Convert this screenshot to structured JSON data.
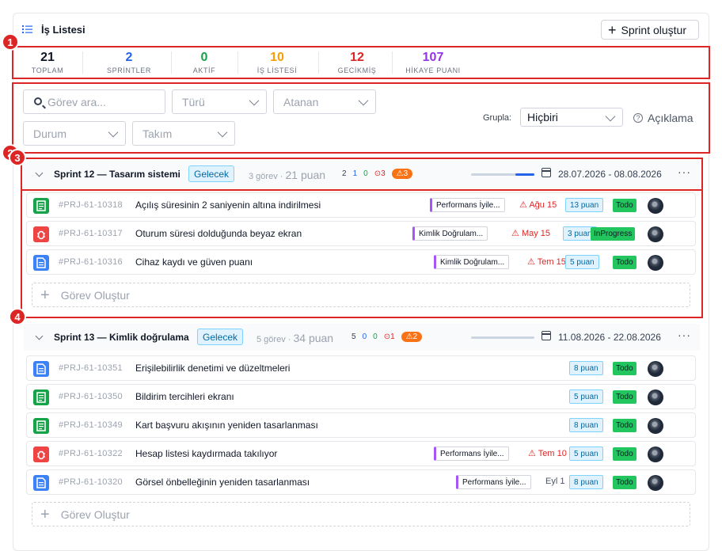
{
  "header": {
    "title": "İş Listesi",
    "create_sprint": "Sprint oluştur"
  },
  "stats": [
    {
      "value": "21",
      "label": "TOPLAM",
      "color": "#111827"
    },
    {
      "value": "2",
      "label": "SPRİNTLER",
      "color": "#2563eb"
    },
    {
      "value": "0",
      "label": "AKTİF",
      "color": "#16a34a"
    },
    {
      "value": "10",
      "label": "İŞ LİSTESİ",
      "color": "#f59e0b"
    },
    {
      "value": "12",
      "label": "GECİKMİŞ",
      "color": "#dc2626"
    },
    {
      "value": "107",
      "label": "HİKAYE PUANI",
      "color": "#9333ea"
    }
  ],
  "filters": {
    "search_placeholder": "Görev ara...",
    "type": "Türü",
    "assignee": "Atanan",
    "status": "Durum",
    "team": "Takım",
    "group_label": "Grupla:",
    "group_value": "Hiçbiri",
    "legend": "Açıklama"
  },
  "annotations": [
    "1",
    "2",
    "3",
    "4"
  ],
  "sprints": [
    {
      "name": "Sprint 12 — Tasarım sistemi",
      "status": "Gelecek",
      "task_count": "3 görev",
      "points": "21 puan",
      "c1": "2",
      "c2": "1",
      "c3": "0",
      "overdue": "3",
      "warn": "3",
      "dates": "28.07.2026 - 08.08.2026",
      "progress": 0.3,
      "tasks": [
        {
          "type": "story",
          "id": "#PRJ-61-10318",
          "title": "Açılış süresinin 2 saniyenin altına indirilmesi",
          "epic": "Performans İyile...",
          "due": "Ağu 15",
          "overdue": true,
          "points": "13 puan",
          "status": "Todo"
        },
        {
          "type": "bug",
          "id": "#PRJ-61-10317",
          "title": "Oturum süresi dolduğunda beyaz ekran",
          "epic": "Kimlik Doğrulam...",
          "due": "May 15",
          "overdue": true,
          "points": "3 puan",
          "status": "InProgress"
        },
        {
          "type": "task",
          "id": "#PRJ-61-10316",
          "title": "Cihaz kaydı ve güven puanı",
          "epic": "Kimlik Doğrulam...",
          "due": "Tem 15",
          "overdue": true,
          "points": "5 puan",
          "status": "Todo"
        }
      ],
      "create_label": "Görev Oluştur"
    },
    {
      "name": "Sprint 13 — Kimlik doğrulama",
      "status": "Gelecek",
      "task_count": "5 görev",
      "points": "34 puan",
      "c1": "5",
      "c2": "0",
      "c3": "0",
      "overdue": "1",
      "warn": "2",
      "dates": "11.08.2026 - 22.08.2026",
      "progress": 0,
      "tasks": [
        {
          "type": "task",
          "id": "#PRJ-61-10351",
          "title": "Erişilebilirlik denetimi ve düzeltmeleri",
          "points": "8 puan",
          "status": "Todo"
        },
        {
          "type": "story",
          "id": "#PRJ-61-10350",
          "title": "Bildirim tercihleri ekranı",
          "points": "5 puan",
          "status": "Todo"
        },
        {
          "type": "story",
          "id": "#PRJ-61-10349",
          "title": "Kart başvuru akışının yeniden tasarlanması",
          "points": "8 puan",
          "status": "Todo"
        },
        {
          "type": "bug",
          "id": "#PRJ-61-10322",
          "title": "Hesap listesi kaydırmada takılıyor",
          "epic": "Performans İyile...",
          "due": "Tem 10",
          "overdue": true,
          "points": "5 puan",
          "status": "Todo"
        },
        {
          "type": "task",
          "id": "#PRJ-61-10320",
          "title": "Görsel önbelleğinin yeniden tasarlanması",
          "epic": "Performans İyile...",
          "due": "Eyl 1",
          "overdue": false,
          "points": "8 puan",
          "status": "Todo"
        }
      ],
      "create_label": "Görev Oluştur"
    }
  ]
}
